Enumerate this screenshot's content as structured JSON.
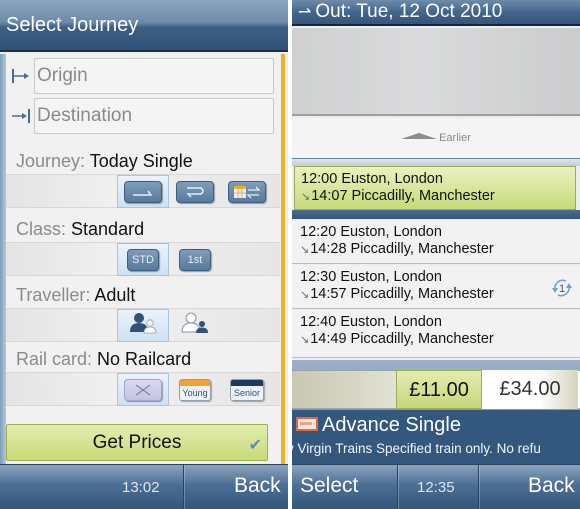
{
  "left_screen": {
    "title": "Select Journey",
    "origin_placeholder": "Origin",
    "destination_placeholder": "Destination",
    "journey": {
      "label": "Journey:",
      "value": "Today Single",
      "options": [
        "single",
        "return",
        "open-return-calendar"
      ],
      "selected": "single"
    },
    "class": {
      "label": "Class:",
      "value": "Standard",
      "options": [
        "STD",
        "1st"
      ],
      "selected": "STD"
    },
    "traveller": {
      "label": "Traveller:",
      "value": "Adult",
      "options": [
        "adult",
        "child"
      ],
      "selected": "adult"
    },
    "railcard": {
      "label": "Rail card:",
      "value": "No Railcard",
      "options": [
        "none",
        "Young",
        "Senior"
      ],
      "selected": "none"
    },
    "get_prices_label": "Get Prices",
    "bottom": {
      "time": "13:02",
      "back_label": "Back"
    }
  },
  "right_screen": {
    "title": "Out: Tue, 12 Oct 2010",
    "earlier_label": "Earlier",
    "journeys": [
      {
        "depart": "12:00 Euston, London",
        "arrive": "14:07 Piccadilly, Manchester",
        "selected": true,
        "changes": null
      },
      {
        "depart": "12:20 Euston, London",
        "arrive": "14:28 Piccadilly, Manchester",
        "selected": false,
        "changes": null
      },
      {
        "depart": "12:30 Euston, London",
        "arrive": "14:57 Piccadilly, Manchester",
        "selected": false,
        "changes": "1"
      },
      {
        "depart": "12:40 Euston, London",
        "arrive": "14:49 Piccadilly, Manchester",
        "selected": false,
        "changes": null
      }
    ],
    "prices": {
      "selected": "£11.00",
      "other": "£34.00"
    },
    "fare": {
      "name": "Advance Single",
      "description": "y Virgin Trains  Specified train only. No refu"
    },
    "bottom": {
      "select_label": "Select",
      "time": "12:35",
      "back_label": "Back"
    }
  },
  "colors": {
    "accent_green": "#c8da78",
    "header_blue": "#34577c",
    "scroll_orange": "#e8b22c"
  }
}
